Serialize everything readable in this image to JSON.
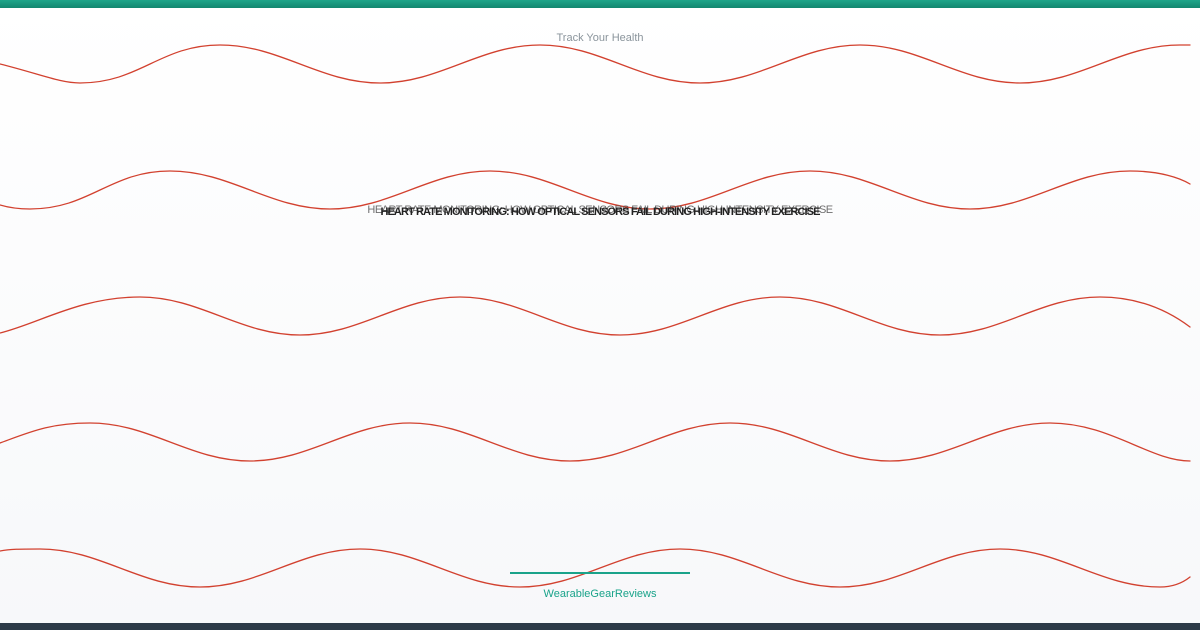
{
  "tagline": "Track Your Health",
  "headline": "HEART RATE MONITORING: HOW OPTICAL SENSORS FAIL DURING HIGH-INTENSITY EXERCISE",
  "brand": "WearableGearReviews",
  "colors": {
    "accent": "#1aa38a",
    "wave": "#d2412f",
    "footer": "#2c3a47"
  }
}
